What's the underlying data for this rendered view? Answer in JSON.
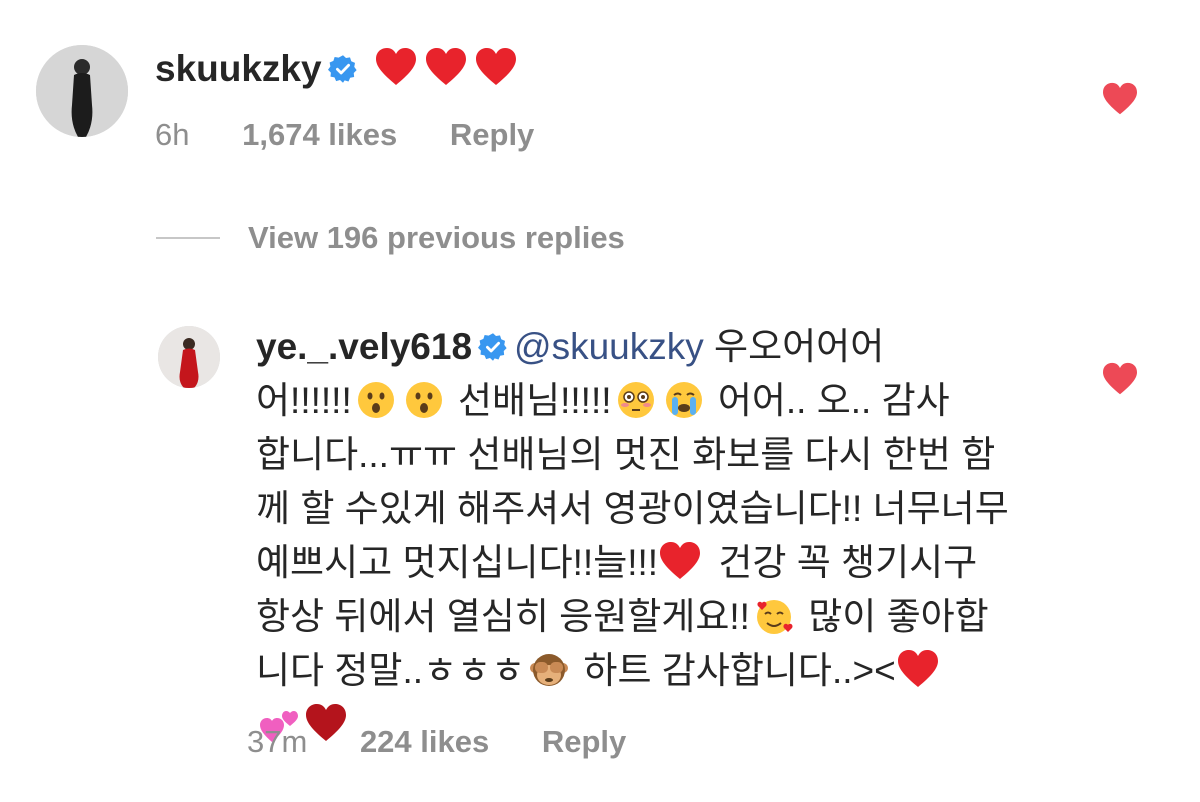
{
  "comment": {
    "username": "skuukzky",
    "verified": true,
    "hearts_count": 3,
    "time": "6h",
    "likes": "1,674 likes",
    "reply_label": "Reply",
    "liked": true
  },
  "view_replies": {
    "label": "View 196 previous replies"
  },
  "reply": {
    "username": "ye._.vely618",
    "verified": true,
    "mention": "@skuukzky",
    "text": {
      "seg1": "우오어어어",
      "seg2": "어!!!!!!",
      "seg3": "선배님!!!!!",
      "seg4": "어어.. 오.. 감사",
      "seg5": "합니다...ㅠㅠ 선배님의 멋진 화보를 다시 한번 함",
      "seg6": "께 할 수있게 해주셔서 영광이였습니다!! 너무너무",
      "seg7": "예쁘시고 멋지십니다!!늘!!!",
      "seg8": "건강 꼭 챙기시구",
      "seg9": "항상 뒤에서 열심히 응원할게요!!",
      "seg10": "많이 좋아합",
      "seg11": "니다 정말..ㅎㅎㅎ",
      "seg12": "하트 감사합니다..><"
    },
    "time": "37m",
    "likes": "224 likes",
    "reply_label": "Reply",
    "liked": true
  },
  "colors": {
    "text": "#262626",
    "meta": "#8e8e8e",
    "mention": "#385185",
    "heart": "#ed4956",
    "verified": "#3897f0"
  },
  "icons": {
    "verified": "verified-badge-icon",
    "like": "heart-icon",
    "emojis": [
      "hushed-face",
      "flushed-face",
      "crying-face",
      "red-heart",
      "smiling-face-with-hearts",
      "see-no-evil-monkey",
      "two-hearts"
    ]
  }
}
